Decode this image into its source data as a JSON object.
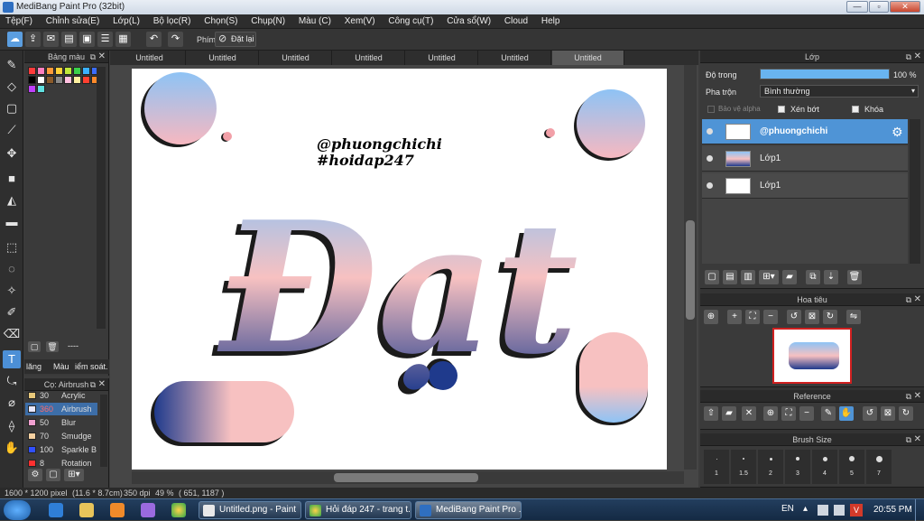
{
  "window": {
    "title": "MediBang Paint Pro (32bit)"
  },
  "menu": [
    "Tệp(F)",
    "Chỉnh sửa(E)",
    "Lớp(L)",
    "Bộ lọc(R)",
    "Chọn(S)",
    "Chụp(N)",
    "Màu (C)",
    "Xem(V)",
    "Công cụ(T)",
    "Cửa sổ(W)",
    "Cloud",
    "Help"
  ],
  "toolbar": {
    "phim_label": "Phím",
    "reset_label": "Đặt lại"
  },
  "tabs": [
    "Untitled",
    "Untitled",
    "Untitled",
    "Untitled",
    "Untitled",
    "Untitled",
    "Untitled"
  ],
  "color_panel": {
    "title": "Bảng màu",
    "swatches": [
      "#ff3b3b",
      "#ff7fc0",
      "#ff9a3a",
      "#ffd23a",
      "#bfe83a",
      "#3ad04a",
      "#3ab0ff",
      "#3a6cff",
      "#000000",
      "#ffffff",
      "#8a5a2a",
      "#8a8a8a",
      "#ffc0e0",
      "#fff0a0",
      "#ff4030",
      "#ff8a2a",
      "#c040ff",
      "#60e0e0"
    ],
    "footer_text": "----",
    "tab_a": "lăng",
    "tab_b": "Màu",
    "tab_c": "iểm soát."
  },
  "brush_panel": {
    "title": "Cọ: Airbrush",
    "items": [
      {
        "size": "30",
        "name": "Acrylic",
        "color": "#e8c87a"
      },
      {
        "size": "360",
        "name": "Airbrush",
        "color": "#e8e8ff"
      },
      {
        "size": "50",
        "name": "Blur",
        "color": "#f0a0d0"
      },
      {
        "size": "70",
        "name": "Smudge",
        "color": "#f4d0a0"
      },
      {
        "size": "100",
        "name": "Sparkle B",
        "color": "#3050ff"
      },
      {
        "size": "8",
        "name": "Rotation",
        "color": "#ff3030"
      }
    ]
  },
  "canvas": {
    "handle": "@phuongchichi",
    "hashtag": "#hoidap247",
    "art_text": "Đạt",
    "gradient_top": "#8ec3f5",
    "gradient_mid": "#f7c1c1",
    "gradient_bottom": "#1f3a8c"
  },
  "layer_panel": {
    "title": "Lớp",
    "opacity_label": "Độ trong",
    "opacity_value": "100 %",
    "opacity_fraction": 1.0,
    "blend_label": "Pha trộn",
    "blend_value": "Bình thường",
    "protect_alpha": "Bảo vệ alpha",
    "clip": "Xén bớt",
    "lock": "Khóa",
    "layers": [
      {
        "name": "@phuongchichi",
        "selected": true
      },
      {
        "name": "Lớp1",
        "selected": false
      },
      {
        "name": "Lớp1",
        "selected": false
      }
    ]
  },
  "navigator": {
    "title": "Hoa tiêu"
  },
  "reference": {
    "title": "Reference"
  },
  "brush_size": {
    "title": "Brush Size",
    "labels": [
      "1",
      "1.5",
      "2",
      "3",
      "4",
      "5",
      "7"
    ]
  },
  "status": {
    "dims": "1600 * 1200 pixel",
    "physical": "(11.6 * 8.7cm)",
    "dpi": "350 dpi",
    "zoom": "49 %",
    "coords": "( 651, 1187 )"
  },
  "taskbar": {
    "items": [
      "Untitled.png - Paint",
      "Hỏi đáp 247 - trang t...",
      "MediBang Paint Pro ..."
    ],
    "lang": "EN",
    "time": "20:55 PM"
  }
}
